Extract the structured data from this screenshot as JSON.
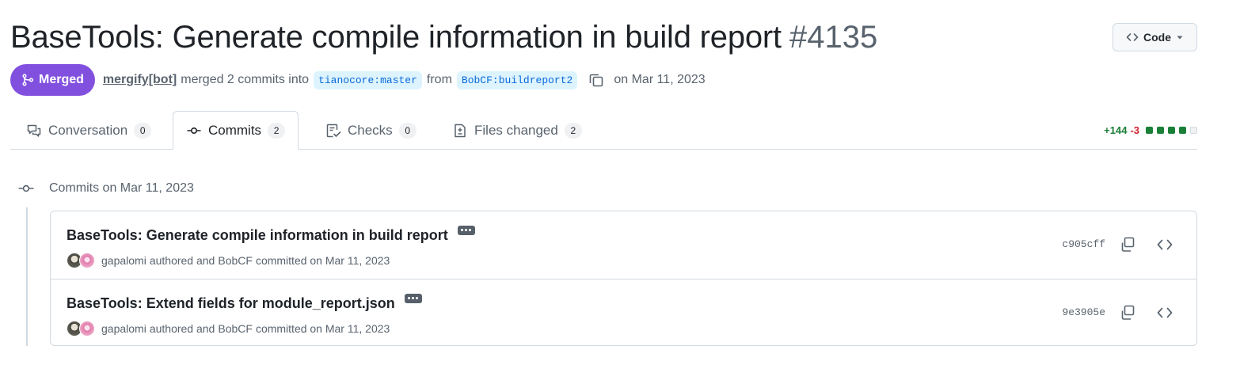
{
  "header": {
    "title": "BaseTools: Generate compile information in build report",
    "pr_number": "#4135",
    "code_button": "Code"
  },
  "meta": {
    "status": "Merged",
    "author": "mergify[bot]",
    "text_merged": "merged 2 commits into",
    "base_branch": "tianocore:master",
    "text_from": "from",
    "head_branch": "BobCF:buildreport2",
    "date": "on Mar 11, 2023"
  },
  "tabs": [
    {
      "label": "Conversation",
      "count": "0",
      "icon": "comment-discussion-icon"
    },
    {
      "label": "Commits",
      "count": "2",
      "icon": "git-commit-icon"
    },
    {
      "label": "Checks",
      "count": "0",
      "icon": "checklist-icon"
    },
    {
      "label": "Files changed",
      "count": "2",
      "icon": "file-diff-icon"
    }
  ],
  "diffstat": {
    "additions": "+144",
    "deletions": "-3",
    "boxes": [
      "#1a7f37",
      "#1a7f37",
      "#1a7f37",
      "#1a7f37",
      "#eff1f3"
    ]
  },
  "timeline": {
    "date_heading": "Commits on Mar 11, 2023"
  },
  "commits": [
    {
      "title": "BaseTools: Generate compile information in build report",
      "author": "gapalomi",
      "authored_text": "authored and",
      "committer": "BobCF",
      "committed_text": "committed on Mar 11, 2023",
      "sha": "c905cff"
    },
    {
      "title": "BaseTools: Extend fields for module_report.json",
      "author": "gapalomi",
      "authored_text": "authored and",
      "committer": "BobCF",
      "committed_text": "committed on Mar 11, 2023",
      "sha": "9e3905e"
    }
  ],
  "colors": {
    "merged": "#8250df",
    "branch_bg": "#ddf4ff",
    "branch_fg": "#0969da",
    "additions": "#1a7f37",
    "deletions": "#cf222e"
  }
}
